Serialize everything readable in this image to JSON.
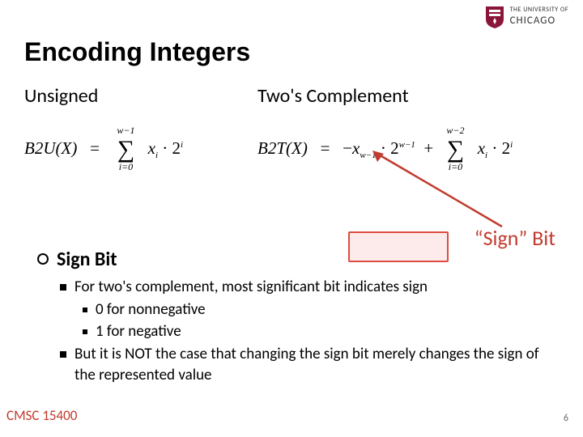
{
  "logo": {
    "line1": "THE UNIVERSITY OF",
    "line2": "CHICAGO"
  },
  "title": "Encoding Integers",
  "columns": {
    "unsigned": "Unsigned",
    "twos": "Two's Complement"
  },
  "formulas": {
    "b2u_lhs": "B2U(X)",
    "b2u_eq": "=",
    "b2u_sum_top": "w−1",
    "b2u_sum_bot": "i=0",
    "b2u_term_x": "x",
    "b2u_term_xsub": "i",
    "b2u_term_dot": "·",
    "b2u_term_base": "2",
    "b2u_term_exp": "i",
    "b2t_lhs": "B2T(X)",
    "b2t_eq": "=",
    "b2t_neg": "−",
    "b2t_x": "x",
    "b2t_xsub": "w−1",
    "b2t_dot": "·",
    "b2t_base": "2",
    "b2t_exp": "w−1",
    "b2t_plus": "+",
    "b2t_sum_top": "w−2",
    "b2t_sum_bot": "i=0",
    "b2t_term_x": "x",
    "b2t_term_xsub": "i",
    "b2t_term_dot": "·",
    "b2t_term_base": "2",
    "b2t_term_exp": "i"
  },
  "callout": "“Sign” Bit",
  "section": {
    "heading": "Sign Bit",
    "bullets": [
      "For two's complement, most significant bit indicates sign",
      "But it is NOT the case that changing the sign bit merely changes the sign of the represented value"
    ],
    "sub_bullets": [
      "0 for nonnegative",
      "1 for negative"
    ]
  },
  "footer": {
    "course": "CMSC 15400",
    "page": "6"
  }
}
